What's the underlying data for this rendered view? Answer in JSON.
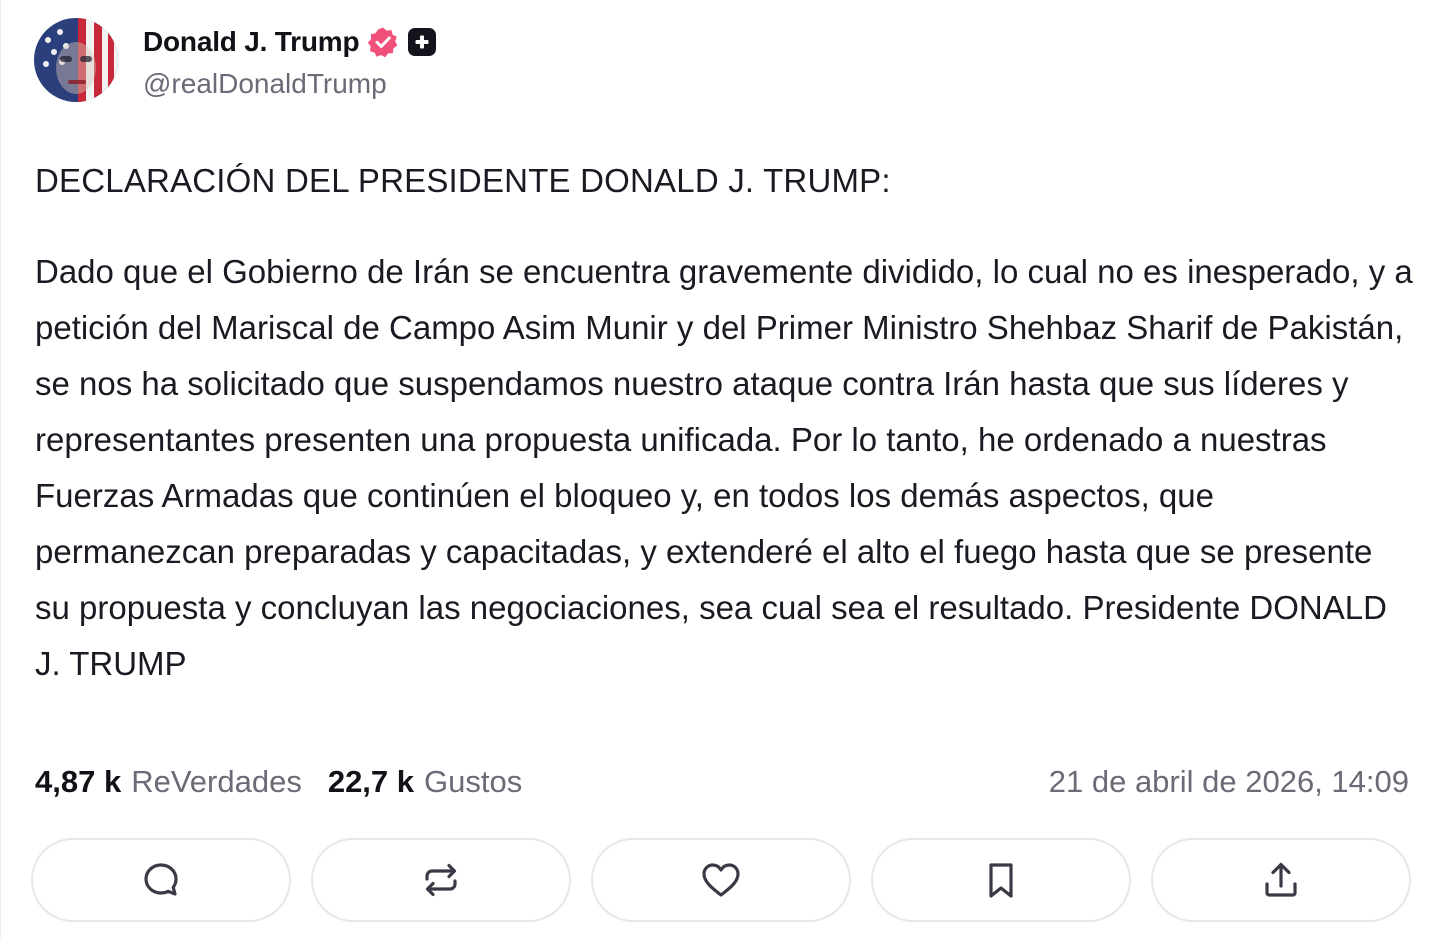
{
  "author": {
    "display_name": "Donald J. Trump",
    "handle": "@realDonaldTrump",
    "verified_icon": "verified-badge-icon",
    "plus_icon": "plus-badge-icon",
    "verified_color": "#f0507a"
  },
  "post": {
    "heading": "DECLARACIÓN DEL PRESIDENTE DONALD J. TRUMP:",
    "body": "Dado que el Gobierno de Irán se encuentra gravemente dividido, lo cual no es inesperado, y a petición del Mariscal de Campo Asim Munir y del Primer Ministro Shehbaz Sharif de Pakistán, se nos ha solicitado que suspendamos nuestro ataque contra Irán hasta que sus líderes y representantes presenten una propuesta unificada. Por lo tanto, he ordenado a nuestras Fuerzas Armadas que continúen el bloqueo y, en todos los demás aspectos, que permanezcan preparadas y capacitadas, y extenderé el alto el fuego hasta que se presente su propuesta y concluyan las negociaciones, sea cual sea el resultado. Presidente DONALD J. TRUMP"
  },
  "stats": {
    "reposts_count": "4,87 k",
    "reposts_label": "ReVerdades",
    "likes_count": "22,7 k",
    "likes_label": "Gustos",
    "timestamp": "21 de abril de 2026, 14:09"
  },
  "actions": [
    {
      "icon": "reply-icon"
    },
    {
      "icon": "repost-icon"
    },
    {
      "icon": "heart-icon"
    },
    {
      "icon": "bookmark-icon"
    },
    {
      "icon": "share-icon"
    }
  ]
}
